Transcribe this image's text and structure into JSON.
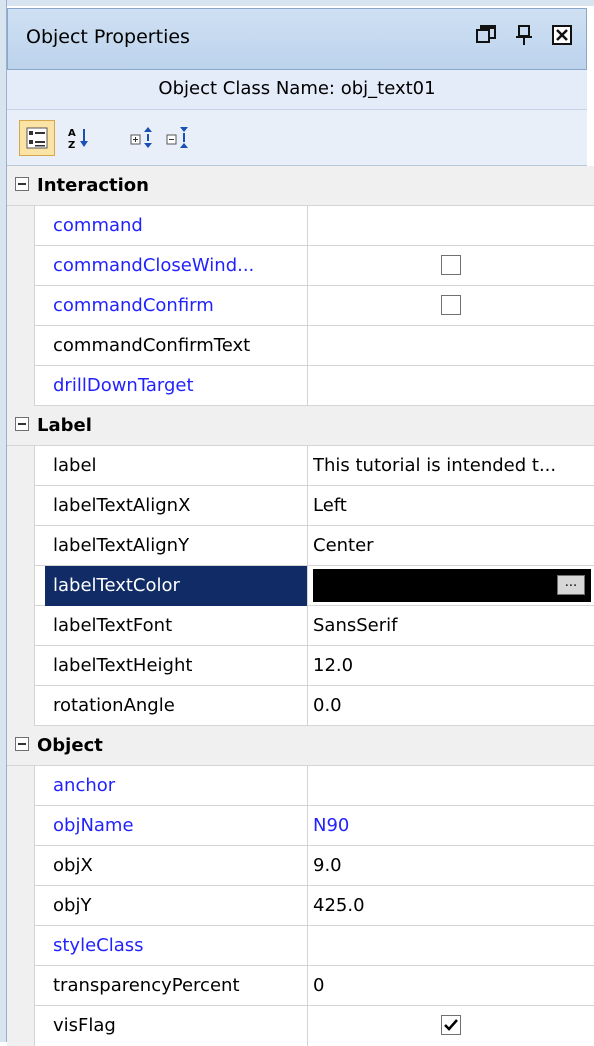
{
  "window": {
    "title": "Object Properties",
    "class_name_text": "Object Class Name: obj_text01",
    "icons": [
      "restore-window-icon",
      "pin-icon",
      "close-icon"
    ]
  },
  "toolbar": {
    "buttons": [
      "categorized-view-icon",
      "alphabetical-sort-icon",
      "expand-all-icon",
      "collapse-all-icon"
    ]
  },
  "categories": {
    "interaction": "Interaction",
    "label": "Label",
    "object": "Object"
  },
  "properties": {
    "command": {
      "name": "command",
      "value": ""
    },
    "commandCloseWindow": {
      "name": "commandCloseWind...",
      "value": ""
    },
    "commandConfirm": {
      "name": "commandConfirm",
      "value": ""
    },
    "commandConfirmText": {
      "name": "commandConfirmText",
      "value": ""
    },
    "drillDownTarget": {
      "name": "drillDownTarget",
      "value": ""
    },
    "label": {
      "name": "label",
      "value": "This tutorial is intended t..."
    },
    "labelTextAlignX": {
      "name": "labelTextAlignX",
      "value": "Left"
    },
    "labelTextAlignY": {
      "name": "labelTextAlignY",
      "value": "Center"
    },
    "labelTextColor": {
      "name": "labelTextColor",
      "value": "",
      "color": "#000000",
      "button": "..."
    },
    "labelTextFont": {
      "name": "labelTextFont",
      "value": "SansSerif"
    },
    "labelTextHeight": {
      "name": "labelTextHeight",
      "value": "12.0"
    },
    "rotationAngle": {
      "name": "rotationAngle",
      "value": "0.0"
    },
    "anchor": {
      "name": "anchor",
      "value": ""
    },
    "objName": {
      "name": "objName",
      "value": "N90"
    },
    "objX": {
      "name": "objX",
      "value": "9.0"
    },
    "objY": {
      "name": "objY",
      "value": "425.0"
    },
    "styleClass": {
      "name": "styleClass",
      "value": ""
    },
    "transparencyPercent": {
      "name": "transparencyPercent",
      "value": "0"
    },
    "visFlag": {
      "name": "visFlag",
      "value": "",
      "checked": true
    }
  },
  "colors": {
    "selection": "#102b66",
    "modified_property": "#2222ff",
    "header": "#bcd3ec"
  }
}
